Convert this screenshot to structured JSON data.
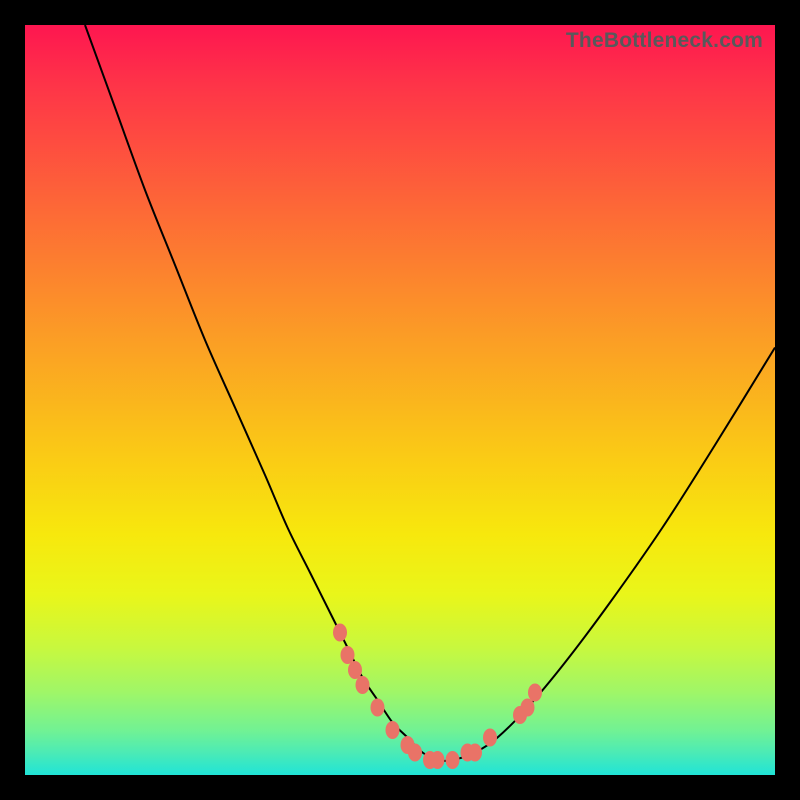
{
  "watermark": "TheBottleneck.com",
  "chart_data": {
    "type": "line",
    "title": "",
    "xlabel": "",
    "ylabel": "",
    "xlim": [
      0,
      100
    ],
    "ylim": [
      0,
      100
    ],
    "grid": false,
    "legend": false,
    "series": [
      {
        "name": "bottleneck-curve",
        "x": [
          8,
          12,
          16,
          20,
          24,
          28,
          32,
          35,
          38,
          41,
          43,
          45,
          47,
          49,
          51,
          53,
          55,
          57,
          60,
          63,
          67,
          72,
          78,
          85,
          92,
          100
        ],
        "y": [
          100,
          89,
          78,
          68,
          58,
          49,
          40,
          33,
          27,
          21,
          17,
          13,
          10,
          7,
          5,
          3,
          2,
          2,
          3,
          5,
          9,
          15,
          23,
          33,
          44,
          57
        ]
      }
    ],
    "markers": {
      "name": "highlight-points",
      "color": "#E97367",
      "points": [
        {
          "x": 42,
          "y": 19
        },
        {
          "x": 43,
          "y": 16
        },
        {
          "x": 44,
          "y": 14
        },
        {
          "x": 45,
          "y": 12
        },
        {
          "x": 47,
          "y": 9
        },
        {
          "x": 49,
          "y": 6
        },
        {
          "x": 51,
          "y": 4
        },
        {
          "x": 52,
          "y": 3
        },
        {
          "x": 54,
          "y": 2
        },
        {
          "x": 55,
          "y": 2
        },
        {
          "x": 57,
          "y": 2
        },
        {
          "x": 59,
          "y": 3
        },
        {
          "x": 60,
          "y": 3
        },
        {
          "x": 62,
          "y": 5
        },
        {
          "x": 66,
          "y": 8
        },
        {
          "x": 67,
          "y": 9
        },
        {
          "x": 68,
          "y": 11
        }
      ]
    }
  }
}
